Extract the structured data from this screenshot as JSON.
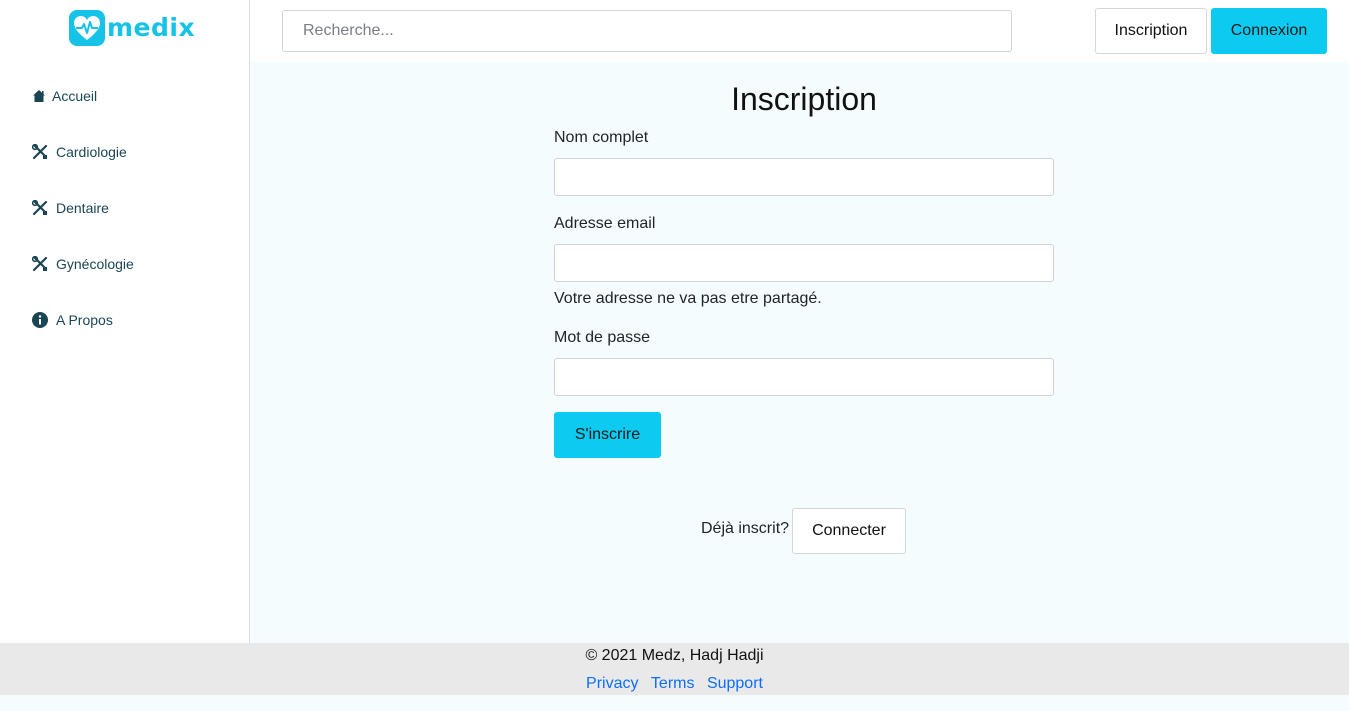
{
  "brand": {
    "name": "medix",
    "color": "#16c3e8"
  },
  "sidebar": {
    "items": [
      {
        "label": "Accueil",
        "icon": "home-icon"
      },
      {
        "label": "Cardiologie",
        "icon": "tools-icon"
      },
      {
        "label": "Dentaire",
        "icon": "tools-icon"
      },
      {
        "label": "Gynécologie",
        "icon": "tools-icon"
      },
      {
        "label": "A Propos",
        "icon": "info-icon"
      }
    ]
  },
  "header": {
    "search_placeholder": "Recherche...",
    "inscription_label": "Inscription",
    "connexion_label": "Connexion"
  },
  "form": {
    "title": "Inscription",
    "name_label": "Nom complet",
    "name_value": "",
    "email_label": "Adresse email",
    "email_value": "",
    "email_help": "Votre adresse ne va pas etre partagé.",
    "password_label": "Mot de passe",
    "password_value": "",
    "submit_label": "S'inscrire",
    "already_text": "Déjà inscrit?",
    "connect_label": "Connecter"
  },
  "footer": {
    "copyright": "© 2021 Medz, Hadj Hadji",
    "links": [
      "Privacy",
      "Terms",
      "Support"
    ]
  },
  "colors": {
    "accent": "#0dcaf0",
    "link": "#0d6efd",
    "nav_text": "#1a4654"
  }
}
